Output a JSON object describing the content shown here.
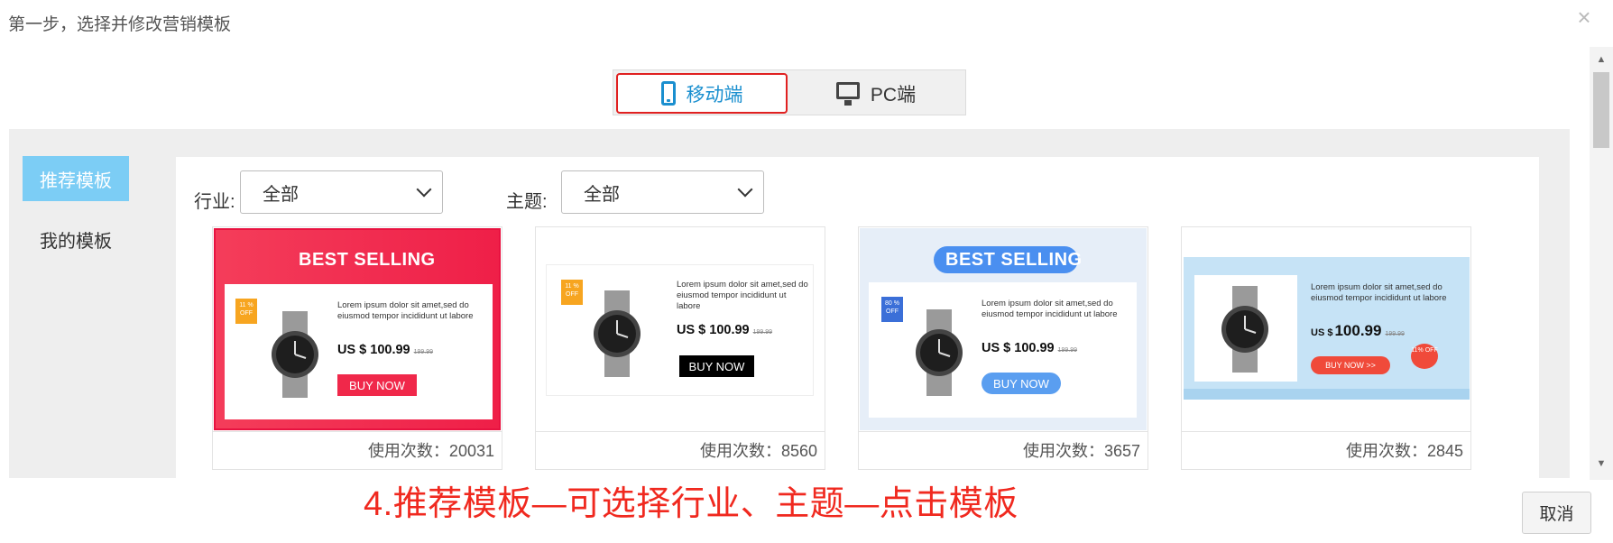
{
  "dialog": {
    "title": "第一步，选择并修改营销模板",
    "close_glyph": "×",
    "cancel_label": "取消"
  },
  "device_tabs": [
    {
      "label": "移动端",
      "icon": "mobile-phone-icon",
      "active": true
    },
    {
      "label": "PC端",
      "icon": "desktop-monitor-icon",
      "active": false
    }
  ],
  "sidebar": {
    "items": [
      {
        "label": "推荐模板",
        "active": true
      },
      {
        "label": "我的模板",
        "active": false
      }
    ]
  },
  "filters": {
    "industry": {
      "label": "行业:",
      "value": "全部"
    },
    "theme": {
      "label": "主题:",
      "value": "全部"
    }
  },
  "templates": [
    {
      "usage_label": "使用次数：20031",
      "preview": {
        "headline": "BEST SELLING",
        "badge": "11 % OFF",
        "description": "Lorem ipsum dolor sit amet,sed do eiusmod tempor incididunt ut labore",
        "price": "US $ 100.99",
        "old_price": "199.99",
        "button": "BUY NOW",
        "accent_color": "#f0284a"
      }
    },
    {
      "usage_label": "使用次数：8560",
      "preview": {
        "headline": "",
        "badge": "11 % OFF",
        "description": "Lorem ipsum dolor sit amet,sed do eiusmod tempor incididunt ut labore",
        "price": "US $ 100.99",
        "old_price": "199.99",
        "button": "BUY NOW",
        "accent_color": "#000000"
      }
    },
    {
      "usage_label": "使用次数：3657",
      "preview": {
        "headline": "BEST SELLING",
        "badge": "80 % OFF",
        "description": "Lorem ipsum dolor sit amet,sed do eiusmod tempor incididunt ut labore",
        "price": "US $ 100.99",
        "old_price": "199.99",
        "button": "BUY NOW",
        "accent_color": "#5a9ef0"
      }
    },
    {
      "usage_label": "使用次数：2845",
      "preview": {
        "headline": "",
        "badge": "11% OFF",
        "description": "Lorem ipsum dolor sit amet,sed do eiusmod tempor incididunt ut labore",
        "price_prefix": "US $",
        "price_value": "100.99",
        "old_price": "199.99",
        "button": "BUY NOW >>",
        "accent_color": "#f04a3a"
      }
    }
  ],
  "annotation": "4.推荐模板—可选择行业、主题—点击模板",
  "colors": {
    "tab_active_border": "#e02020",
    "tab_active_text": "#1a8fcf",
    "sidebar_active_bg": "#7ccdf5",
    "annotation": "#f0291f"
  }
}
